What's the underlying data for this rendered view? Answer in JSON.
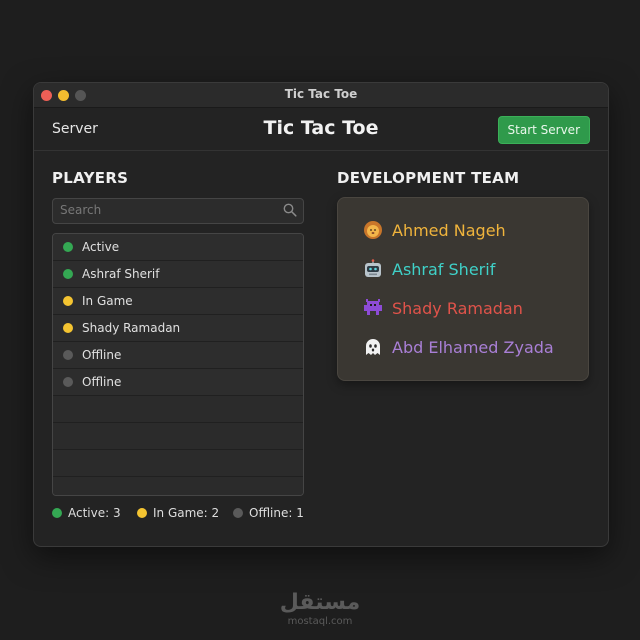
{
  "window": {
    "title": "Tic Tac Toe"
  },
  "toolbar": {
    "server_label": "Server",
    "app_title": "Tic Tac Toe",
    "start_button": "Start Server"
  },
  "players": {
    "title": "PLAYERS",
    "search_placeholder": "Search",
    "rows": [
      {
        "label": "Active",
        "status": "active"
      },
      {
        "label": "Ashraf Sherif",
        "status": "active"
      },
      {
        "label": "In Game",
        "status": "ingame"
      },
      {
        "label": "Shady Ramadan",
        "status": "ingame"
      },
      {
        "label": "Offline",
        "status": "offline"
      },
      {
        "label": "Offline",
        "status": "offline"
      }
    ],
    "legend": {
      "active": "Active: 3",
      "ingame": "In Game: 2",
      "offline": "Offline: 1"
    }
  },
  "team": {
    "title": "DEVELOPMENT TEAM",
    "members": [
      {
        "name": "Ahmed Nageh",
        "icon": "lion-icon",
        "color": "#f0b43c"
      },
      {
        "name": "Ashraf Sherif",
        "icon": "robot-icon",
        "color": "#3fd1c8"
      },
      {
        "name": "Shady Ramadan",
        "icon": "alien-monster-icon",
        "color": "#e0534a"
      },
      {
        "name": "Abd Elhamed Zyada",
        "icon": "ghost-icon",
        "color": "#a97fd6"
      }
    ]
  },
  "status_colors": {
    "active": "#34a853",
    "ingame": "#f4c431",
    "offline": "#5a5a5a"
  },
  "watermark": {
    "arabic": "مستقل",
    "latin": "mostaql.com"
  }
}
